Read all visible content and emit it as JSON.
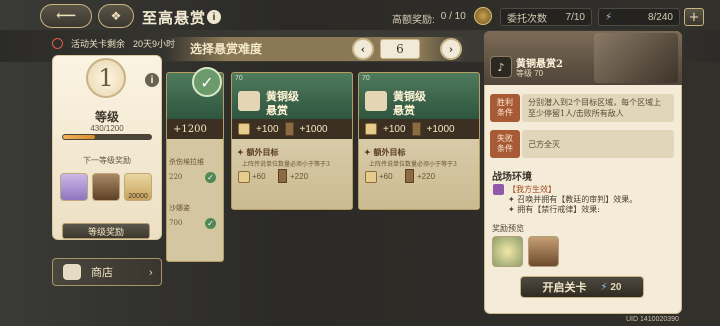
{
  "header": {
    "title": "至高悬赏",
    "high_reward_label": "高额奖励:",
    "high_reward_value": "0 / 10",
    "commission_label": "委托次数",
    "commission_value": "7/10",
    "energy_value": "8/240"
  },
  "left": {
    "timer_label": "活动关卡剩余",
    "timer_value": "20天9小时",
    "level_number": "1",
    "level_title": "等级",
    "level_progress": "430/1200",
    "level_progress_fraction": 0.358,
    "next_reward_label": "下一等级奖励",
    "reward_count": "20000",
    "level_reward_button": "等级奖励",
    "shop_button": "商店"
  },
  "difficulty": {
    "label": "选择悬赏难度",
    "value": "6"
  },
  "cards": [
    {
      "level": "",
      "title_l1": "",
      "title_l2": "",
      "reward_chip": "",
      "reward_wood": "+1200",
      "extra_label": "",
      "extra_desc_1": "杀伤埃拉维",
      "extra_desc_2": "沙娜姿",
      "val_a": "220",
      "val_b": "700"
    },
    {
      "level": "70",
      "title_l1": "黄铜级",
      "title_l2": "悬赏",
      "reward_chip": "+100",
      "reward_wood": "+1000",
      "extra_label": "额外目标",
      "extra_desc": "上阵传说单位数量必须小于等于3",
      "val_a": "+60",
      "val_b": "+220"
    },
    {
      "level": "70",
      "title_l1": "黄铜级",
      "title_l2": "悬赏",
      "reward_chip": "+100",
      "reward_wood": "+1000",
      "extra_label": "额外目标",
      "extra_desc": "上阵传说单位数量必须小于等于3",
      "val_a": "+60",
      "val_b": "+220"
    }
  ],
  "detail": {
    "title": "黄铜悬赏2",
    "level": "等级 70",
    "win_label_1": "胜利",
    "win_label_2": "条件",
    "win_text": "分别潜入到2个目标区域，每个区域上至少停留1人/击败所有敌人",
    "lose_label_1": "失败",
    "lose_label_2": "条件",
    "lose_text": "己方全灭",
    "env_title": "战场环境",
    "env_tag": "【我方生效】",
    "env_line_1": "✦ 召唤并拥有【教廷的审判】效果。",
    "env_line_2": "✦ 拥有【禁行戒律】效果:",
    "reward_preview_label": "奖励预览",
    "start_button": "开启关卡",
    "start_cost": "20"
  },
  "uid": "UID 1410020390",
  "colors": {
    "accent_gold": "#c9b37e",
    "green_banner": "#2f5540",
    "red_label": "#a85a35"
  }
}
